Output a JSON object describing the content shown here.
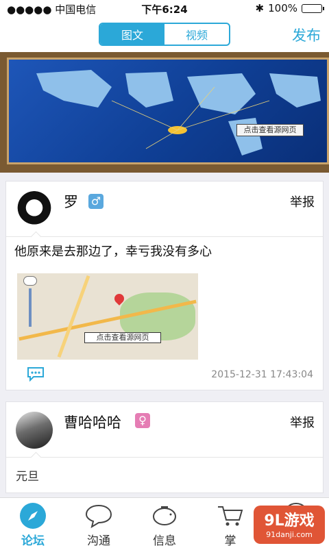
{
  "status_bar": {
    "carrier": "●●●●● 中国电信",
    "time": "下午6:24",
    "battery": "100%"
  },
  "header": {
    "tabs": [
      "图文",
      "视频"
    ],
    "active_tab": 0,
    "publish": "发布"
  },
  "banner": {
    "label": "点击查看源网页",
    "dots": 7,
    "active_dot": 6
  },
  "posts": [
    {
      "user": "罗",
      "gender": "male",
      "gender_symbol": "♂",
      "report": "举报",
      "text": "他原来是去那边了，幸亏我没有多心",
      "image_label": "点击查看源网页",
      "timestamp": "2015-12-31 17:43:04"
    },
    {
      "user": "曹哈哈哈",
      "gender": "female",
      "gender_symbol": "♀",
      "report": "举报",
      "text": "元旦"
    }
  ],
  "tabbar": {
    "items": [
      {
        "label": "论坛",
        "icon": "compass-icon",
        "active": true
      },
      {
        "label": "沟通",
        "icon": "chat-bubble-icon",
        "active": false
      },
      {
        "label": "信息",
        "icon": "piggy-bank-icon",
        "active": false
      },
      {
        "label": "掌",
        "icon": "cart-icon",
        "active": false
      },
      {
        "label": "",
        "icon": "profile-icon",
        "active": false
      }
    ]
  },
  "watermark": {
    "main": "9L游戏",
    "sub": "91danji.com"
  },
  "colors": {
    "accent": "#2ba8d8",
    "male": "#5aa8de",
    "female": "#e57db4"
  }
}
